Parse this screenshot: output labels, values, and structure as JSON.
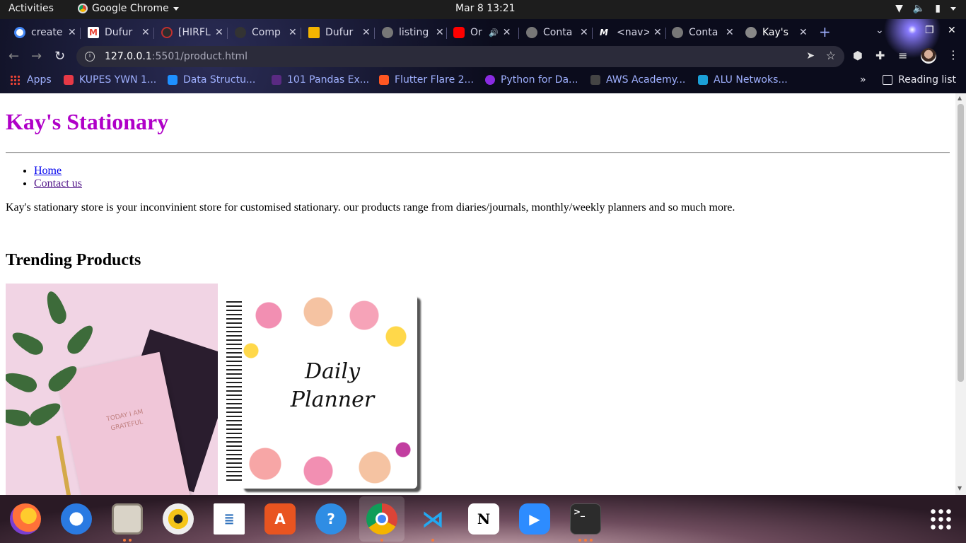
{
  "topbar": {
    "activities": "Activities",
    "app_name": "Google Chrome",
    "clock": "Mar 8  13:21"
  },
  "tabs": [
    {
      "title": "create",
      "fav_color": "#4285f4"
    },
    {
      "title": "Dufur",
      "fav_color": "#ea4335"
    },
    {
      "title": "[HIRFL",
      "fav_color": "#c03030"
    },
    {
      "title": "Comp",
      "fav_color": "#333333"
    },
    {
      "title": "Dufur",
      "fav_color": "#f4b400"
    },
    {
      "title": "listing",
      "fav_color": "#777777"
    },
    {
      "title": "Or",
      "fav_color": "#ff0000"
    },
    {
      "title": "Conta",
      "fav_color": "#777777"
    },
    {
      "title": "<nav>",
      "fav_color": "#ffffff"
    },
    {
      "title": "Conta",
      "fav_color": "#777777"
    },
    {
      "title": "Kay's",
      "fav_color": "#777777"
    }
  ],
  "omnibox": {
    "host": "127.0.0.1",
    "rest": ":5501/product.html"
  },
  "bookmarks": [
    {
      "label": "Apps"
    },
    {
      "label": "KUPES YWN 1...",
      "color": "#e63946"
    },
    {
      "label": "Data Structu...",
      "color": "#1e90ff"
    },
    {
      "label": "101 Pandas Ex...",
      "color": "#5a2a82"
    },
    {
      "label": "Flutter Flare 2...",
      "color": "#ff5722"
    },
    {
      "label": "Python for Da...",
      "color": "#8a2be2"
    },
    {
      "label": "AWS Academy...",
      "color": "#444444"
    },
    {
      "label": "ALU Netwoks...",
      "color": "#1ba0d7"
    }
  ],
  "reading_list": "Reading list",
  "page": {
    "title": "Kay's Stationary",
    "nav": [
      "Home",
      "Contact us"
    ],
    "intro": "Kay's stationary store is your inconvinient store for customised stationary. our products range from diaries/journals, monthly/weekly planners and so much more.",
    "section_title": "Trending Products",
    "product1_text": "TODAY I AM GRATEFUL",
    "product2_text": "Daily Planner"
  },
  "dock": [
    "Firefox",
    "Thunderbird",
    "Files",
    "Rhythmbox",
    "LibreOffice Writer",
    "Ubuntu Software",
    "Help",
    "Google Chrome",
    "Visual Studio Code",
    "Notion",
    "Zoom",
    "Terminal"
  ]
}
